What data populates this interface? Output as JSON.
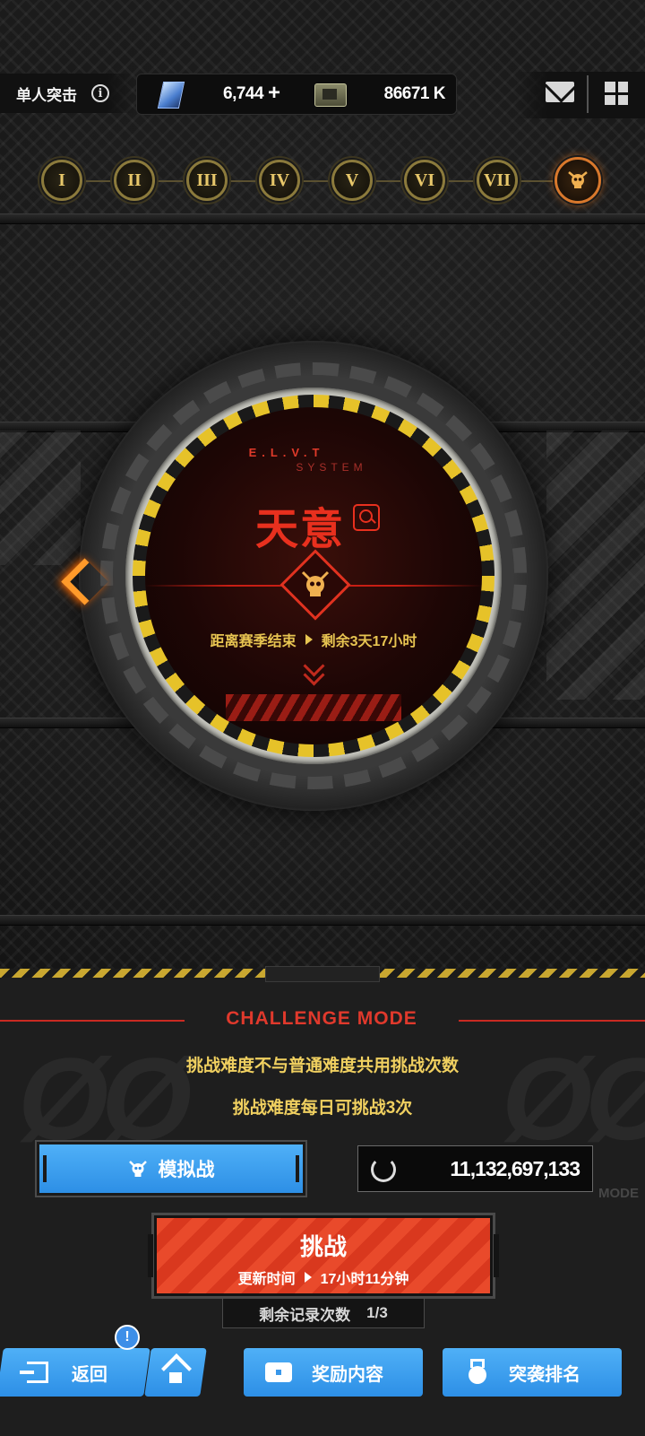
{
  "header": {
    "mode_title": "单人突击",
    "gems": "6,744",
    "plus": "+",
    "credits": "86671 K"
  },
  "stages": [
    "I",
    "II",
    "III",
    "IV",
    "V",
    "VI",
    "VII"
  ],
  "dial": {
    "system_line1": "E.L.V.T",
    "system_line2": "SYSTEM",
    "boss_name": "天意",
    "season_label": "距离赛季结束",
    "season_remaining": "剩余3天17小时"
  },
  "challenge": {
    "title": "CHALLENGE MODE",
    "note1": "挑战难度不与普通难度共用挑战次数",
    "note2": "挑战难度每日可挑战3次",
    "simulate_label": "模拟战",
    "score": "11,132,697,133",
    "watermark": "MODE",
    "button_title": "挑战",
    "refresh_label": "更新时间",
    "refresh_time": "17小时11分钟",
    "records_label": "剩余记录次数",
    "records_value": "1/3"
  },
  "nav": {
    "back": "返回",
    "badge": "!",
    "rewards": "奖励内容",
    "ranking": "突袭排名"
  },
  "colors": {
    "accent_red": "#e8301e",
    "gold": "#e7c451",
    "blue": "#3a98ea"
  }
}
